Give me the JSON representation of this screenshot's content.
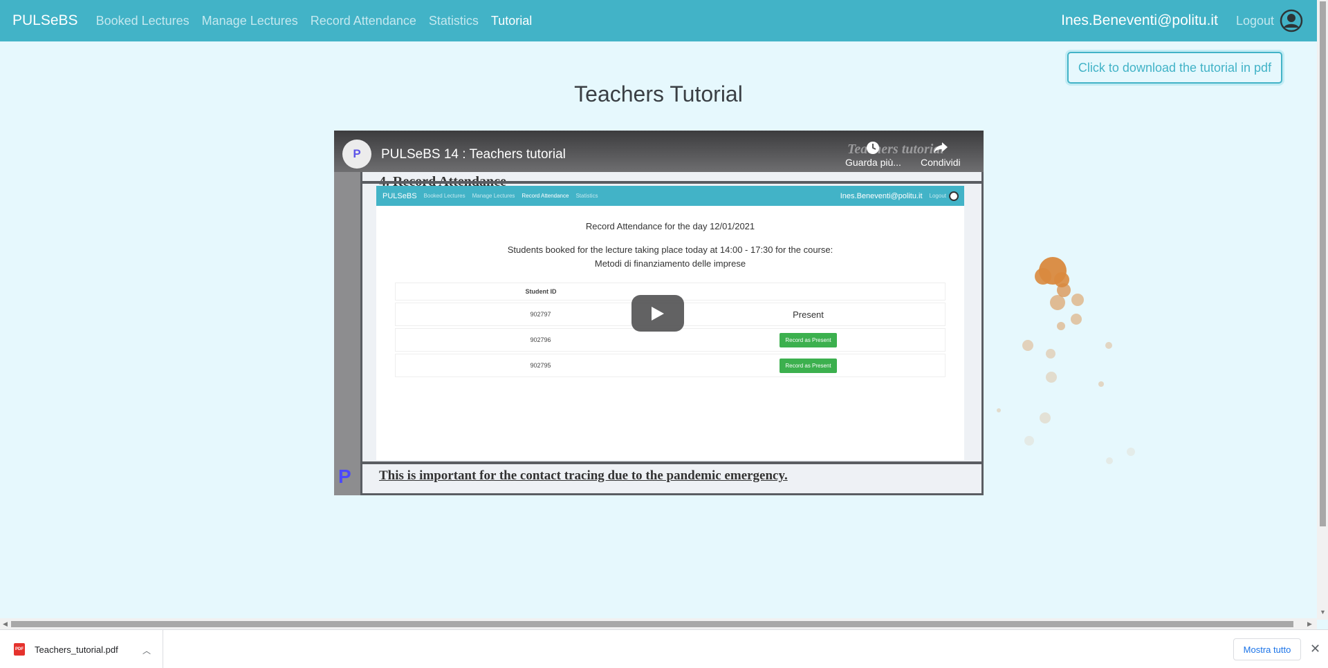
{
  "navbar": {
    "brand": "PULSeBS",
    "links": [
      "Booked Lectures",
      "Manage Lectures",
      "Record Attendance",
      "Statistics",
      "Tutorial"
    ],
    "active_link": "Tutorial",
    "user_email": "Ines.Beneventi@politu.it",
    "logout": "Logout",
    "user_icon": "user-circle-icon"
  },
  "download_button": "Click to download the tutorial in pdf",
  "page_title": "Teachers Tutorial",
  "video": {
    "title": "PULSeBS 14 : Teachers tutorial",
    "watermark": "Teachers tutorial",
    "watch_later": "Guarda più...",
    "share": "Condividi",
    "slide_heading": "4.   Record Attendance",
    "slide_footer": "This is important for the contact tracing due to the pandemic emergency.",
    "inner_app": {
      "brand": "PULSeBS",
      "links": [
        "Booked Lectures",
        "Manage Lectures",
        "Record Attendance",
        "Statistics"
      ],
      "user_email": "Ines.Beneventi@politu.it",
      "logout": "Logout",
      "heading": "Record Attendance for the day 12/01/2021",
      "subheading": "Students booked for the lecture taking place today at 14:00 - 17:30 for the course:",
      "course": "Metodi di finanziamento delle imprese",
      "table_header": "Student ID",
      "rows": [
        {
          "id": "902797",
          "action": "Present"
        },
        {
          "id": "902796",
          "action": "Record as Present"
        },
        {
          "id": "902795",
          "action": "Record as Present"
        }
      ]
    }
  },
  "downloads": {
    "file_name": "Teachers_tutorial.pdf",
    "file_icon": "PDF",
    "show_all": "Mostra tutto"
  },
  "colors": {
    "navbar": "#42b3c7",
    "background": "#e6f8fd",
    "record_button": "#3cb04e"
  }
}
